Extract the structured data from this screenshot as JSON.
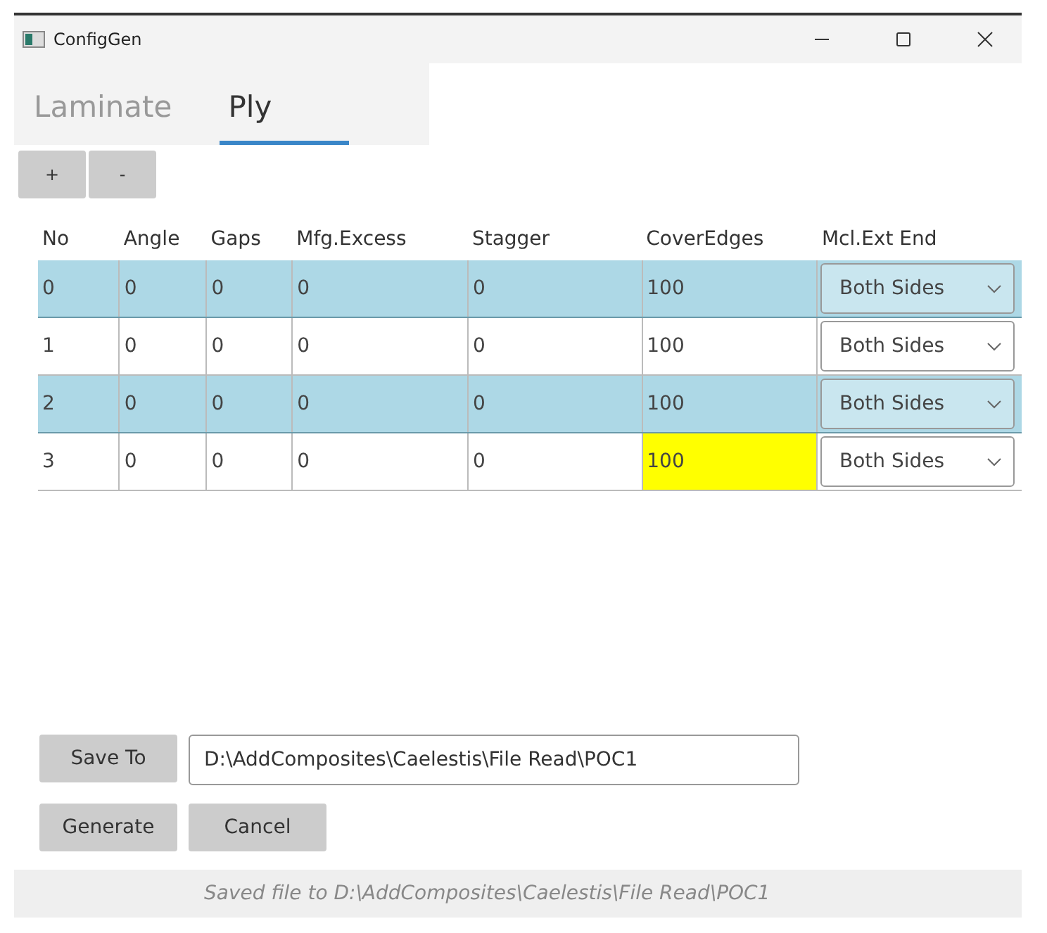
{
  "window": {
    "title": "ConfigGen"
  },
  "tabs": [
    {
      "label": "Laminate",
      "selected": false
    },
    {
      "label": "Ply",
      "selected": true
    }
  ],
  "toolbar": {
    "buttons": [
      "+",
      "-"
    ]
  },
  "table": {
    "columns": [
      "No",
      "Angle",
      "Gaps",
      "Mfg.Excess",
      "Stagger",
      "CoverEdges",
      "Mcl.Ext End"
    ],
    "rows": [
      {
        "cells": [
          "0",
          "0",
          "0",
          "0",
          "0",
          "100"
        ],
        "dropdown": "Both Sides",
        "selected": true,
        "cover_edges_flagged": false
      },
      {
        "cells": [
          "1",
          "0",
          "0",
          "0",
          "0",
          "100"
        ],
        "dropdown": "Both Sides",
        "selected": false,
        "cover_edges_flagged": false
      },
      {
        "cells": [
          "2",
          "0",
          "0",
          "0",
          "0",
          "100"
        ],
        "dropdown": "Both Sides",
        "selected": true,
        "cover_edges_flagged": false
      },
      {
        "cells": [
          "3",
          "0",
          "0",
          "0",
          "0",
          "100"
        ],
        "dropdown": "Both Sides",
        "selected": false,
        "cover_edges_flagged": true
      }
    ]
  },
  "save_to": {
    "button": "Save To",
    "value": "D:\\AddComposites\\Caelestis\\File Read\\POC1"
  },
  "actions": [
    "Generate",
    "Cancel"
  ],
  "status_bar": "Saved file to D:\\AddComposites\\Caelestis\\File Read\\POC1"
}
